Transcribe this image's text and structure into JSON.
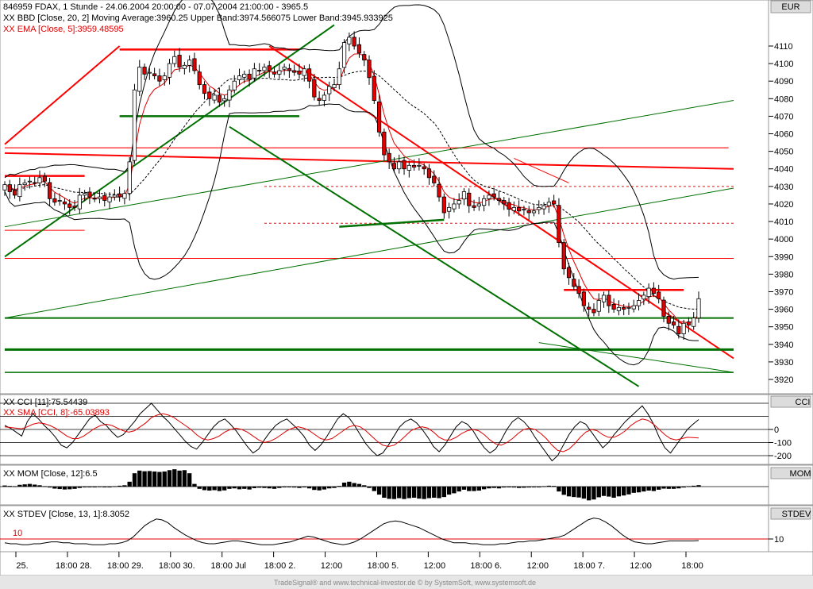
{
  "header": {
    "title_line": "846959  FDAX, 1 Stunde - 24.06.2004 20:00:00 - 07.07.2004 21:00:00 - 3965.5",
    "bbd_line": "XX BBD [Close, 20, 2] Moving Average:3960.25 Upper Band:3974.566075 Lower Band:3945.933925",
    "ema_line": "XX EMA [Close, 5]:3959.48595"
  },
  "panels": {
    "price_unit": "EUR",
    "cci_title": "CCI",
    "cci_line": "XX CCI [11]:75.54439",
    "cci_sma_line": "XX SMA [CCI, 8]:-65.03893",
    "mom_title": "MOM",
    "mom_line": "XX MOM [Close, 12]:6.5",
    "stdev_title": "STDEV",
    "stdev_line": "XX STDEV [Close, 13, 1]:8.3052",
    "stdev_ref_label": "10"
  },
  "footer": "TradeSignal® and www.technical-investor.de © by SystemSoft, www.systemsoft.de",
  "colors": {
    "up": "#ffffff",
    "down": "#e00000",
    "ema": "#e00000",
    "trend_red": "#ff0000",
    "trend_green": "#007000",
    "bands": "#000000"
  },
  "chart_data": [
    {
      "type": "candlestick",
      "title": "846959  FDAX, 1 Stunde",
      "ylabel": "EUR",
      "ylim": [
        3915,
        4120
      ],
      "yticks": [
        3920,
        3930,
        3940,
        3950,
        3960,
        3970,
        3980,
        3990,
        4000,
        4010,
        4020,
        4030,
        4040,
        4050,
        4060,
        4070,
        4080,
        4090,
        4100,
        4110
      ],
      "x_labels": [
        "25.",
        "18:00 28.",
        "18:00 29.",
        "18:00 30.",
        "18:00 Jul",
        "18:00 2.",
        "12:00",
        "18:00 5.",
        "12:00",
        "18:00 6.",
        "12:00",
        "18:00 7.",
        "12:00",
        "18:00"
      ],
      "close": [
        4031,
        4027,
        4025,
        4031,
        4032,
        4033,
        4032,
        4035,
        4033,
        4023,
        4021,
        4022,
        4020,
        4018,
        4018,
        4025,
        4026,
        4024,
        4023,
        4024,
        4022,
        4024,
        4025,
        4024,
        4026,
        4044,
        4085,
        4098,
        4094,
        4095,
        4093,
        4090,
        4093,
        4100,
        4104,
        4098,
        4099,
        4102,
        4096,
        4088,
        4083,
        4080,
        4082,
        4078,
        4080,
        4085,
        4090,
        4093,
        4094,
        4091,
        4097,
        4096,
        4098,
        4096,
        4094,
        4096,
        4098,
        4096,
        4095,
        4094,
        4097,
        4090,
        4081,
        4079,
        4082,
        4087,
        4088,
        4097,
        4112,
        4115,
        4110,
        4106,
        4102,
        4092,
        4079,
        4061,
        4048,
        4044,
        4040,
        4044,
        4040,
        4042,
        4041,
        4042,
        4040,
        4035,
        4032,
        4024,
        4015,
        4018,
        4020,
        4022,
        4027,
        4019,
        4018,
        4020,
        4023,
        4025,
        4024,
        4022,
        4020,
        4017,
        4018,
        4016,
        4017,
        4015,
        4016,
        4018,
        4019,
        4021,
        4020,
        3998,
        3983,
        3978,
        3973,
        3969,
        3962,
        3960,
        3958,
        3965,
        3968,
        3962,
        3960,
        3961,
        3960,
        3961,
        3962,
        3965,
        3968,
        3972,
        3969,
        3966,
        3956,
        3952,
        3951,
        3946,
        3952,
        3951,
        3955,
        3966
      ],
      "note": "hourly candles; values read approximately from the price axis"
    },
    {
      "type": "line",
      "title": "CCI",
      "ylim": [
        -260,
        210
      ],
      "yticks": [
        0,
        -100,
        -200
      ],
      "ytick_labels": [
        "0",
        "-100",
        "-200"
      ],
      "series": [
        {
          "name": "CCI [11]",
          "values": [
            30,
            10,
            -20,
            -50,
            60,
            120,
            80,
            30,
            -10,
            -60,
            -120,
            -140,
            -100,
            -40,
            20,
            80,
            110,
            60,
            30,
            -20,
            -60,
            -40,
            10,
            60,
            120,
            160,
            200,
            150,
            100,
            60,
            10,
            -40,
            -90,
            -130,
            -150,
            -100,
            -40,
            20,
            60,
            80,
            40,
            -10,
            -70,
            -130,
            -180,
            -150,
            -80,
            -20,
            30,
            60,
            80,
            40,
            0,
            -50,
            -120,
            -160,
            -120,
            -60,
            10,
            80,
            120,
            90,
            30,
            -40,
            -110,
            -160,
            -200,
            -180,
            -120,
            -50,
            20,
            60,
            80,
            50,
            0,
            -60,
            -130,
            -170,
            -120,
            -50,
            20,
            60,
            40,
            -10,
            -80,
            -140,
            -180,
            -150,
            -80,
            0,
            60,
            90,
            60,
            10,
            -60,
            -120,
            -180,
            -240,
            -200,
            -120,
            -40,
            20,
            60,
            40,
            -20,
            -80,
            -140,
            -100,
            -40,
            10,
            60,
            100,
            140,
            180,
            120,
            40,
            -60,
            -140,
            -180,
            -120,
            -60,
            0,
            40,
            75.5
          ]
        },
        {
          "name": "SMA [CCI, 8]",
          "values": [
            20,
            15,
            10,
            5,
            20,
            40,
            50,
            45,
            30,
            10,
            -20,
            -50,
            -70,
            -70,
            -50,
            -20,
            10,
            30,
            40,
            30,
            10,
            -10,
            -20,
            -10,
            20,
            50,
            90,
            110,
            120,
            110,
            90,
            60,
            30,
            0,
            -40,
            -70,
            -80,
            -70,
            -50,
            -20,
            0,
            10,
            0,
            -20,
            -50,
            -80,
            -100,
            -90,
            -70,
            -40,
            -10,
            10,
            20,
            10,
            -10,
            -40,
            -70,
            -80,
            -70,
            -40,
            -10,
            20,
            30,
            20,
            -10,
            -50,
            -90,
            -120,
            -130,
            -120,
            -90,
            -50,
            -10,
            10,
            20,
            10,
            -20,
            -60,
            -80,
            -80,
            -60,
            -30,
            -10,
            0,
            -10,
            -40,
            -80,
            -110,
            -120,
            -100,
            -70,
            -30,
            0,
            10,
            0,
            -30,
            -70,
            -120,
            -160,
            -170,
            -150,
            -110,
            -60,
            -20,
            0,
            -10,
            -40,
            -60,
            -60,
            -40,
            -10,
            30,
            60,
            80,
            70,
            40,
            0,
            -40,
            -70,
            -80,
            -70,
            -60,
            -62,
            -65.0
          ]
        }
      ]
    },
    {
      "type": "bar",
      "title": "MOM",
      "series": [
        {
          "name": "MOM [Close, 12]",
          "values": [
            5,
            3,
            2,
            8,
            10,
            12,
            9,
            6,
            2,
            -4,
            -9,
            -11,
            -13,
            -12,
            -10,
            -6,
            -3,
            -1,
            0,
            1,
            -2,
            0,
            2,
            4,
            6,
            22,
            60,
            72,
            69,
            70,
            68,
            66,
            68,
            74,
            78,
            72,
            74,
            60,
            12,
            -10,
            -16,
            -18,
            -16,
            -20,
            -17,
            -10,
            -8,
            -12,
            -10,
            -13,
            -7,
            -5,
            -6,
            -8,
            -10,
            -6,
            -3,
            -2,
            -4,
            -6,
            -3,
            -8,
            -15,
            -17,
            -13,
            -8,
            -6,
            3,
            18,
            22,
            16,
            12,
            6,
            -6,
            -20,
            -36,
            -50,
            -55,
            -56,
            -52,
            -56,
            -52,
            -50,
            -54,
            -56,
            -52,
            -50,
            -52,
            -47,
            -36,
            -30,
            -22,
            -14,
            -20,
            -20,
            -18,
            -12,
            -8,
            -6,
            -8,
            -4,
            -2,
            -4,
            -6,
            -5,
            -4,
            -2,
            0,
            2,
            4,
            3,
            -22,
            -37,
            -44,
            -47,
            -49,
            -54,
            -62,
            -58,
            -48,
            -42,
            -45,
            -50,
            -44,
            -40,
            -35,
            -28,
            -26,
            -22,
            -18,
            -20,
            -14,
            -9,
            -10,
            -10,
            -8,
            -4,
            2,
            4,
            6.5
          ]
        }
      ]
    },
    {
      "type": "line",
      "title": "STDEV",
      "yticks": [
        10
      ],
      "ytick_labels": [
        "10"
      ],
      "series": [
        {
          "name": "STDEV [Close, 13, 1]",
          "values": [
            6,
            5,
            5,
            4,
            4,
            5,
            5,
            6,
            7,
            7,
            6,
            6,
            5,
            5,
            5,
            4,
            4,
            4,
            5,
            5,
            6,
            8,
            12,
            18,
            24,
            28,
            31,
            30,
            27,
            22,
            18,
            14,
            11,
            8,
            6,
            5,
            5,
            6,
            7,
            8,
            8,
            7,
            6,
            5,
            4,
            4,
            4,
            5,
            6,
            7,
            9,
            11,
            13,
            12,
            10,
            8,
            6,
            5,
            4,
            5,
            7,
            10,
            14,
            18,
            22,
            26,
            28,
            29,
            28,
            26,
            24,
            22,
            19,
            16,
            13,
            10,
            8,
            6,
            6,
            6,
            5,
            5,
            4,
            4,
            4,
            5,
            5,
            6,
            7,
            7,
            8,
            8,
            9,
            10,
            11,
            12,
            14,
            18,
            22,
            26,
            30,
            32,
            31,
            28,
            24,
            19,
            14,
            10,
            7,
            6,
            5,
            5,
            6,
            7,
            8,
            8,
            8,
            8,
            8,
            8.3
          ]
        }
      ]
    }
  ]
}
